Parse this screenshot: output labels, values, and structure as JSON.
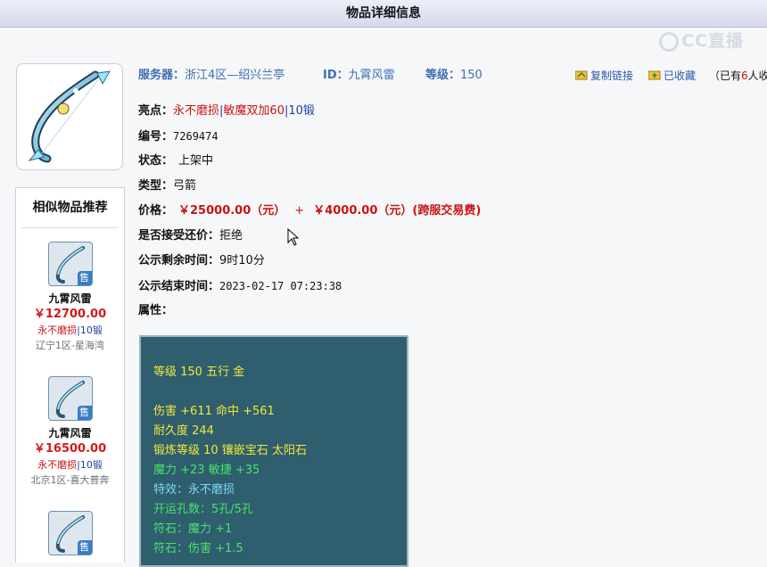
{
  "page": {
    "title": "物品详细信息",
    "watermark": "CC直播"
  },
  "header": {
    "server_label": "服务器：",
    "server_value": "浙江4区—绍兴兰亭",
    "id_label": "ID：",
    "id_value": "九霄风雷",
    "level_label": "等级：",
    "level_value": "150"
  },
  "actions": {
    "copy_link": "复制链接",
    "favorited": "已收藏",
    "fav_prefix": "（已有",
    "fav_count": "6",
    "fav_suffix": "人收藏"
  },
  "details": {
    "highlight_label": "亮点：",
    "highlight_1": "永不磨损",
    "sep": "|",
    "highlight_2": "敏魔双加60",
    "highlight_3": "10锻",
    "number_label": "编号：",
    "number_value": "7269474",
    "status_label": "状态：",
    "status_value": "上架中",
    "type_label": "类型：",
    "type_value": "弓箭",
    "price_label": "价格：",
    "price_main": "￥25000.00（元）",
    "price_plus": "+",
    "price_fee": "￥4000.00（元）(跨服交易费)",
    "counter_label": "是否接受还价：",
    "counter_value": "拒绝",
    "remaining_label": "公示剩余时间：",
    "remaining_value": "9时10分",
    "end_label": "公示结束时间：",
    "end_value": "2023-02-17 07:23:38",
    "attr_label": "属性："
  },
  "attributes": [
    {
      "text": "等级 150 五行 金",
      "color": "yellow"
    },
    {
      "text": "伤害 +611 命中 +561",
      "color": "yellow"
    },
    {
      "text": "耐久度 244",
      "color": "yellow"
    },
    {
      "text": "锻炼等级 10 镶嵌宝石 太阳石",
      "color": "yellow"
    },
    {
      "text": "魔力 +23 敏捷 +35",
      "color": "green"
    },
    {
      "text": "特效：永不磨损",
      "color": "cyan"
    },
    {
      "text": "开运孔数：5孔/5孔",
      "color": "green"
    },
    {
      "text": "符石：魔力 +1",
      "color": "green"
    },
    {
      "text": "符石：伤害 +1.5",
      "color": "green"
    }
  ],
  "sidebar": {
    "title": "相似物品推荐",
    "sale_badge": "售",
    "items": [
      {
        "name": "九霄风雷",
        "price": "￥12700.00",
        "tag_red": "永不磨损",
        "tag_sep": "|",
        "tag_blue": "10锻",
        "server": "辽宁1区-星海湾"
      },
      {
        "name": "九霄风雷",
        "price": "￥16500.00",
        "tag_red": "永不磨损",
        "tag_sep": "|",
        "tag_blue": "10锻",
        "server": "北京1区-喜大普奔"
      },
      {
        "name": "",
        "price": "",
        "tag_red": "",
        "tag_sep": "",
        "tag_blue": "",
        "server": ""
      }
    ]
  },
  "colors": {
    "accent_blue": "#3d6fb0",
    "price_red": "#c81414",
    "attr_bg": "#2f5e6e",
    "attr_yellow": "#f2e83a",
    "attr_green": "#46e46a",
    "attr_cyan": "#7fd8f0"
  },
  "icons": [
    "bow-item-icon",
    "copy-link-icon",
    "favorite-folder-icon",
    "sale-badge",
    "mouse-cursor-icon"
  ]
}
